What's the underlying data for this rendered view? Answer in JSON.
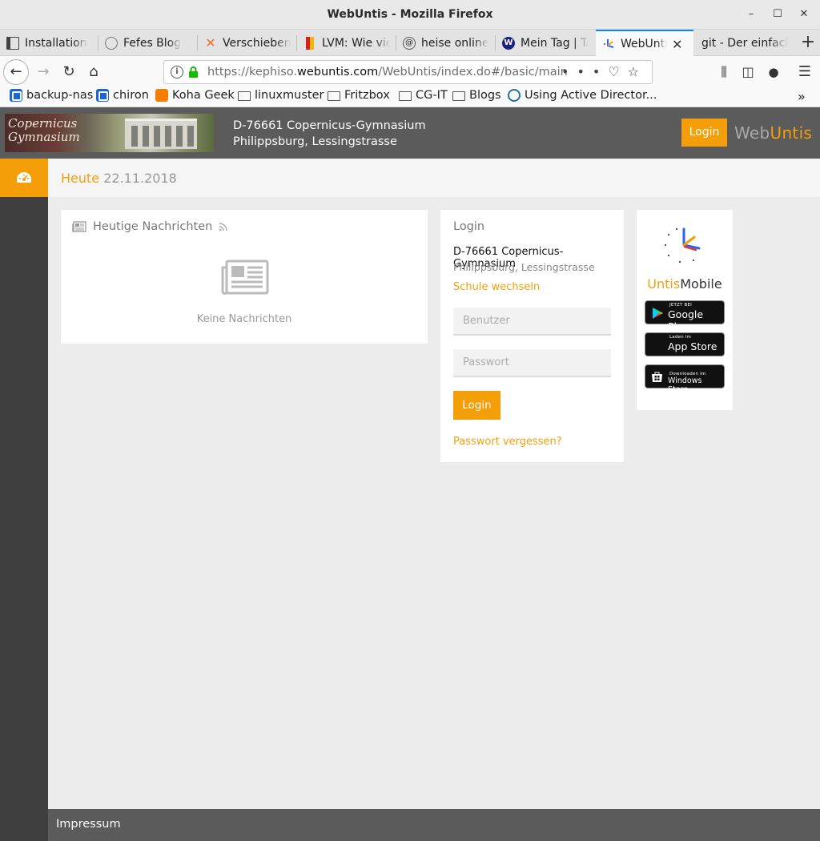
{
  "window": {
    "title": "WebUntis - Mozilla Firefox"
  },
  "tabs": [
    {
      "label": "Installation",
      "icon": "doc-icon"
    },
    {
      "label": "Fefes Blog",
      "icon": "fefe-icon"
    },
    {
      "label": "Verschieben",
      "icon": "x-icon"
    },
    {
      "label": "LVM: Wie vie",
      "icon": "lvm-icon"
    },
    {
      "label": "heise online",
      "icon": "at-icon"
    },
    {
      "label": "Mein Tag | Ta",
      "icon": "w-icon"
    },
    {
      "label": "WebUntis",
      "icon": "untis-icon",
      "active": true
    },
    {
      "label": "git - Der einfach",
      "icon": "none"
    }
  ],
  "urlbar": {
    "prefix": "https://kephiso.",
    "domain": "webuntis.com",
    "path": "/WebUntis/index.do#/basic/main"
  },
  "bookmarks": [
    {
      "label": "backup-nas",
      "icon": "blue-q-icon"
    },
    {
      "label": "chiron",
      "icon": "blue-q-icon"
    },
    {
      "label": "Koha Geek",
      "icon": "blogger-icon"
    },
    {
      "label": "linuxmuster",
      "icon": "folder-icon"
    },
    {
      "label": "Fritzbox",
      "icon": "folder-icon"
    },
    {
      "label": "CG-IT",
      "icon": "folder-icon"
    },
    {
      "label": "Blogs",
      "icon": "folder-icon"
    },
    {
      "label": "Using Active Director...",
      "icon": "wordpress-icon"
    }
  ],
  "header": {
    "school_line1": "D-76661 Copernicus-Gymnasium",
    "school_line2": "Philippsburg, Lessingstrasse",
    "school_logo_text": "Copernicus Gymnasium",
    "login_label": "Login",
    "brand_web": "Web",
    "brand_untis": "Untis"
  },
  "subheader": {
    "today_label": "Heute",
    "date": "22.11.2018"
  },
  "news": {
    "title": "Heutige Nachrichten",
    "empty_text": "Keine Nachrichten"
  },
  "login": {
    "title": "Login",
    "school": "D-76661 Copernicus-Gymnasium",
    "city": "Philippsburg, Lessingstrasse",
    "switch_school": "Schule wechseln",
    "user_placeholder": "Benutzer",
    "pass_placeholder": "Passwort",
    "button": "Login",
    "forgot": "Passwort vergessen?"
  },
  "mobile": {
    "brand_a": "Untis",
    "brand_b": "Mobile",
    "google_small": "JETZT BEI",
    "google_big": "Google Play",
    "apple_small": "Laden im",
    "apple_big": "App Store",
    "windows_small": "Downloaden im",
    "windows_big": "Windows Store"
  },
  "footer": {
    "impressum": "Impressum"
  },
  "colors": {
    "accent": "#f49f0a",
    "header": "#5b5b5b",
    "sidebar": "#3f3f3f"
  }
}
